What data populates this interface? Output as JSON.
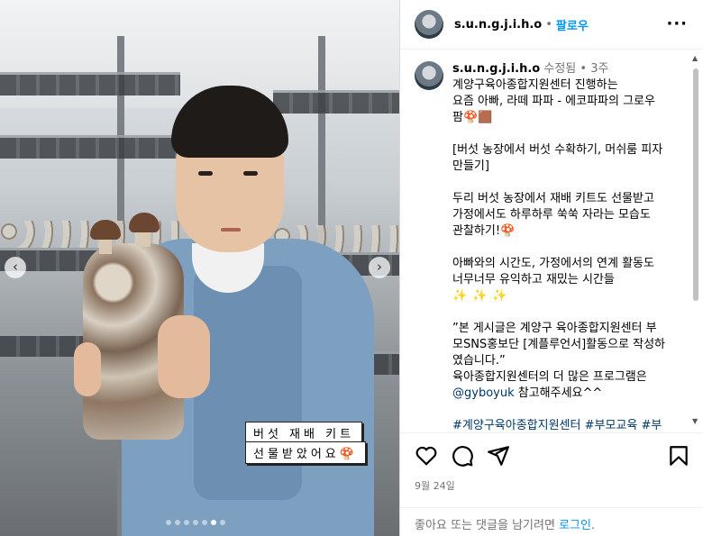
{
  "post": {
    "username": "s.u.n.g.j.i.h.o",
    "follow_label": "팔로우",
    "edited_label": "수정됨",
    "age": "3주",
    "caption_lines": [
      "계양구육아종합지원센터 진행하는",
      "요즘 아빠, 라떼 파파 - 에코파파의 그로우",
      "팜🍄🟫"
    ],
    "para2": [
      "[버섯 농장에서 버섯 수확하기, 머쉬룸 피자",
      "만들기]"
    ],
    "para3": [
      "두리 버섯 농장에서 재배 키트도 선물받고",
      "가정에서도 하루하루 쑥쑥 자라는 모습도",
      "관찰하기!🍄"
    ],
    "para4": [
      "아빠와의 시간도, 가정에서의 연계 활동도",
      "너무너무 유익하고 재밌는 시간들"
    ],
    "sparkles": "✨✨✨",
    "para5": [
      "”본 게시글은 계양구 육아종합지원센터 부",
      "모SNS홍보단 [계플루언서]활동으로 작성하",
      "였습니다.”",
      "육아종합지원센터의 더 많은 프로그램은"
    ],
    "mention": "@gyboyuk",
    "mention_suffix": " 참고해주세요^^",
    "hashtags": "#계양구육아종합지원센터 #부모교육 #부",
    "date": "9월 24일",
    "footer_prefix": "좋아요 또는 댓글을 남기려면 ",
    "footer_login": "로그인",
    "footer_suffix": "."
  },
  "media": {
    "caption_line1": "버섯 재배 키트",
    "caption_line2": "선물받았어요🍄",
    "carousel_total": 7,
    "carousel_active_index": 5
  },
  "icons": [
    "more-icon",
    "chevron-left-icon",
    "chevron-right-icon",
    "heart-icon",
    "comment-icon",
    "share-icon",
    "bookmark-icon"
  ]
}
